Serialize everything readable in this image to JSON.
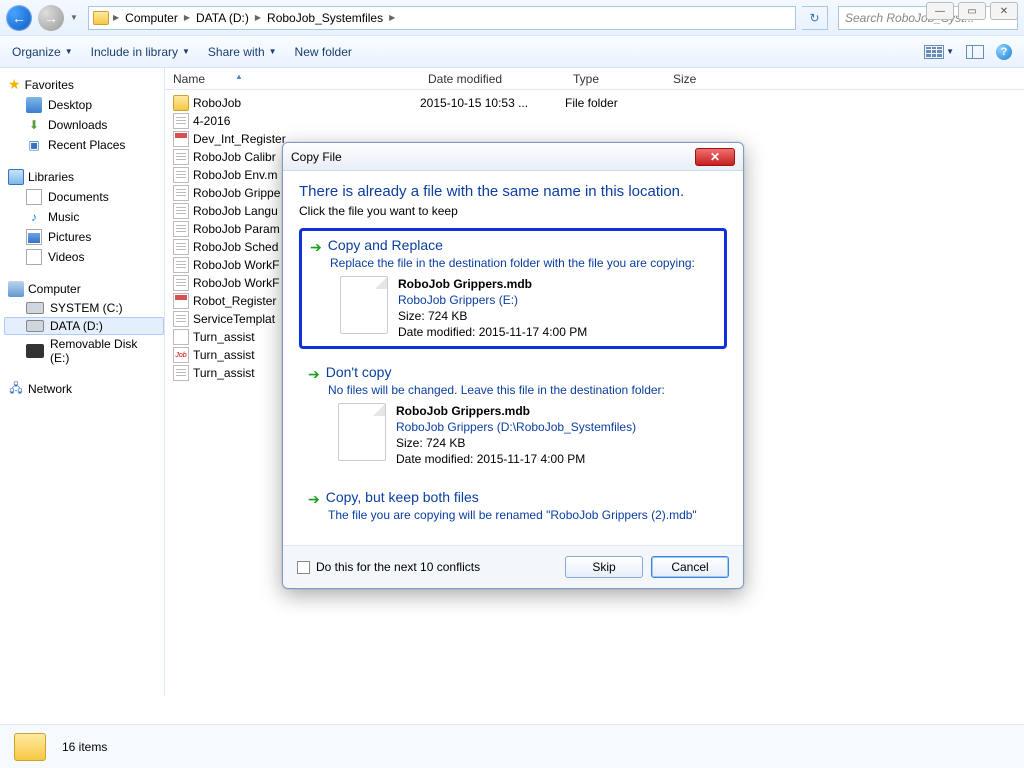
{
  "window_buttons": {
    "min": "—",
    "max": "▭",
    "close": "✕"
  },
  "breadcrumb": [
    "Computer",
    "DATA (D:)",
    "RoboJob_Systemfiles"
  ],
  "search": {
    "placeholder": "Search RoboJob_Syst..."
  },
  "toolbar": {
    "organize": "Organize",
    "include": "Include in library",
    "share": "Share with",
    "newfolder": "New folder"
  },
  "sidebar": {
    "favorites": {
      "label": "Favorites",
      "items": [
        "Desktop",
        "Downloads",
        "Recent Places"
      ]
    },
    "libraries": {
      "label": "Libraries",
      "items": [
        "Documents",
        "Music",
        "Pictures",
        "Videos"
      ]
    },
    "computer": {
      "label": "Computer",
      "drives": [
        "SYSTEM (C:)",
        "DATA (D:)",
        "Removable Disk (E:)"
      ]
    },
    "network": {
      "label": "Network"
    }
  },
  "columns": {
    "name": "Name",
    "date": "Date modified",
    "type": "Type",
    "size": "Size"
  },
  "files": [
    {
      "icon": "folder",
      "name": "RoboJob",
      "date": "2015-10-15 10:53 ...",
      "type": "File folder"
    },
    {
      "icon": "txt",
      "name": "4-2016"
    },
    {
      "icon": "db",
      "name": "Dev_Int_Register"
    },
    {
      "icon": "txt",
      "name": "RoboJob Calibr"
    },
    {
      "icon": "txt",
      "name": "RoboJob Env.m"
    },
    {
      "icon": "txt",
      "name": "RoboJob Grippe"
    },
    {
      "icon": "txt",
      "name": "RoboJob Langu"
    },
    {
      "icon": "txt",
      "name": "RoboJob Param"
    },
    {
      "icon": "txt",
      "name": "RoboJob Sched"
    },
    {
      "icon": "txt",
      "name": "RoboJob WorkF"
    },
    {
      "icon": "txt",
      "name": "RoboJob WorkF"
    },
    {
      "icon": "db",
      "name": "Robot_Register"
    },
    {
      "icon": "txt",
      "name": "ServiceTemplat"
    },
    {
      "icon": "cfg",
      "name": "Turn_assist"
    },
    {
      "icon": "job",
      "name": "Turn_assist"
    },
    {
      "icon": "txt",
      "name": "Turn_assist"
    }
  ],
  "status": {
    "count": "16 items"
  },
  "dialog": {
    "title": "Copy File",
    "heading": "There is already a file with the same name in this location.",
    "sub": "Click the file you want to keep",
    "opt1": {
      "title": "Copy and Replace",
      "sub": "Replace the file in the destination folder with the file you are copying:",
      "file": "RoboJob Grippers.mdb",
      "loc": "RoboJob Grippers (E:)",
      "size": "Size: 724 KB",
      "date": "Date modified: 2015-11-17 4:00 PM"
    },
    "opt2": {
      "title": "Don't copy",
      "sub": "No files will be changed. Leave this file in the destination folder:",
      "file": "RoboJob Grippers.mdb",
      "loc": "RoboJob Grippers (D:\\RoboJob_Systemfiles)",
      "size": "Size: 724 KB",
      "date": "Date modified: 2015-11-17 4:00 PM"
    },
    "opt3": {
      "title": "Copy, but keep both files",
      "sub": "The file you are copying will be renamed \"RoboJob Grippers (2).mdb\""
    },
    "checkbox": "Do this for the next 10 conflicts",
    "skip": "Skip",
    "cancel": "Cancel"
  }
}
